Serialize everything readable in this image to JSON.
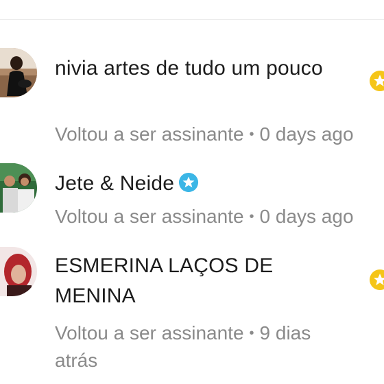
{
  "subscribers": [
    {
      "name": "nivia artes de tudo  um pouco",
      "status": "Voltou a ser assinante",
      "separator": "•",
      "time": "0 days ago",
      "badge_icon": "gold-star-badge-icon"
    },
    {
      "name": "Jete & Neide",
      "status": "Voltou a ser assinante",
      "separator": "•",
      "time": "0 days ago",
      "badge_icon": "blue-star-badge-icon"
    },
    {
      "name": "ESMERINA LAÇOS DE MENINA",
      "status": "Voltou a ser assinante",
      "separator": "•",
      "time": "9 dias atrás",
      "badge_icon": "gold-star-badge-icon"
    }
  ],
  "colors": {
    "name_text": "#1c1c1c",
    "sub_text": "#8a8a8a",
    "badge_gold": "#f5c518",
    "badge_blue": "#3bb6e6"
  }
}
